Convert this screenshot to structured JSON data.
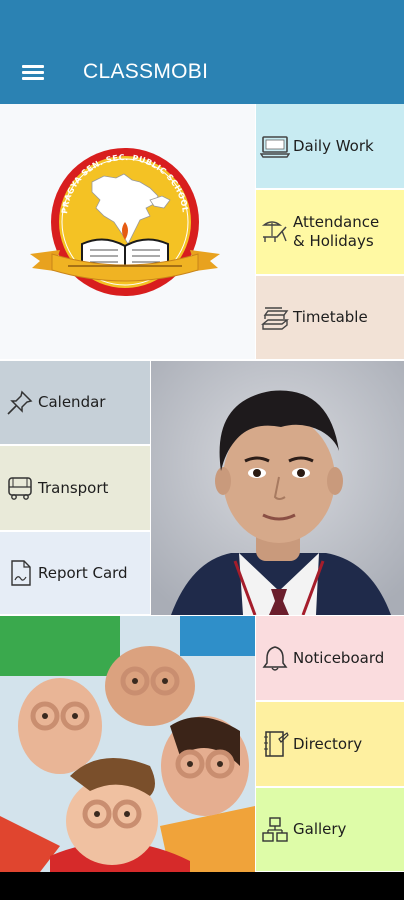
{
  "app": {
    "title": "CLASSMOBI",
    "bar_color": "#2b82b3"
  },
  "school_logo": {
    "name": "PRAGYA SEN. SEC. PUBLIC SCHOOL"
  },
  "tiles": {
    "daily_work": {
      "label": "Daily Work",
      "icon": "laptop-icon",
      "color": "#c8ebf2"
    },
    "attendance": {
      "label": "Attendance & Holidays",
      "icon": "beach-bed-icon",
      "color": "#fff9a3"
    },
    "timetable": {
      "label": "Timetable",
      "icon": "books-stack-icon",
      "color": "#f2e2d6"
    },
    "calendar": {
      "label": "Calendar",
      "icon": "pushpin-icon",
      "color": "#c6d0d8"
    },
    "transport": {
      "label": "Transport",
      "icon": "bus-icon",
      "color": "#e9ead9"
    },
    "report_card": {
      "label": "Report Card",
      "icon": "document-icon",
      "color": "#e6edf6"
    },
    "noticeboard": {
      "label": "Noticeboard",
      "icon": "bell-icon",
      "color": "#fadcde"
    },
    "directory": {
      "label": "Directory",
      "icon": "notebook-icon",
      "color": "#fef0a0"
    },
    "gallery": {
      "label": "Gallery",
      "icon": "gallery-icon",
      "color": "#defca8"
    }
  }
}
